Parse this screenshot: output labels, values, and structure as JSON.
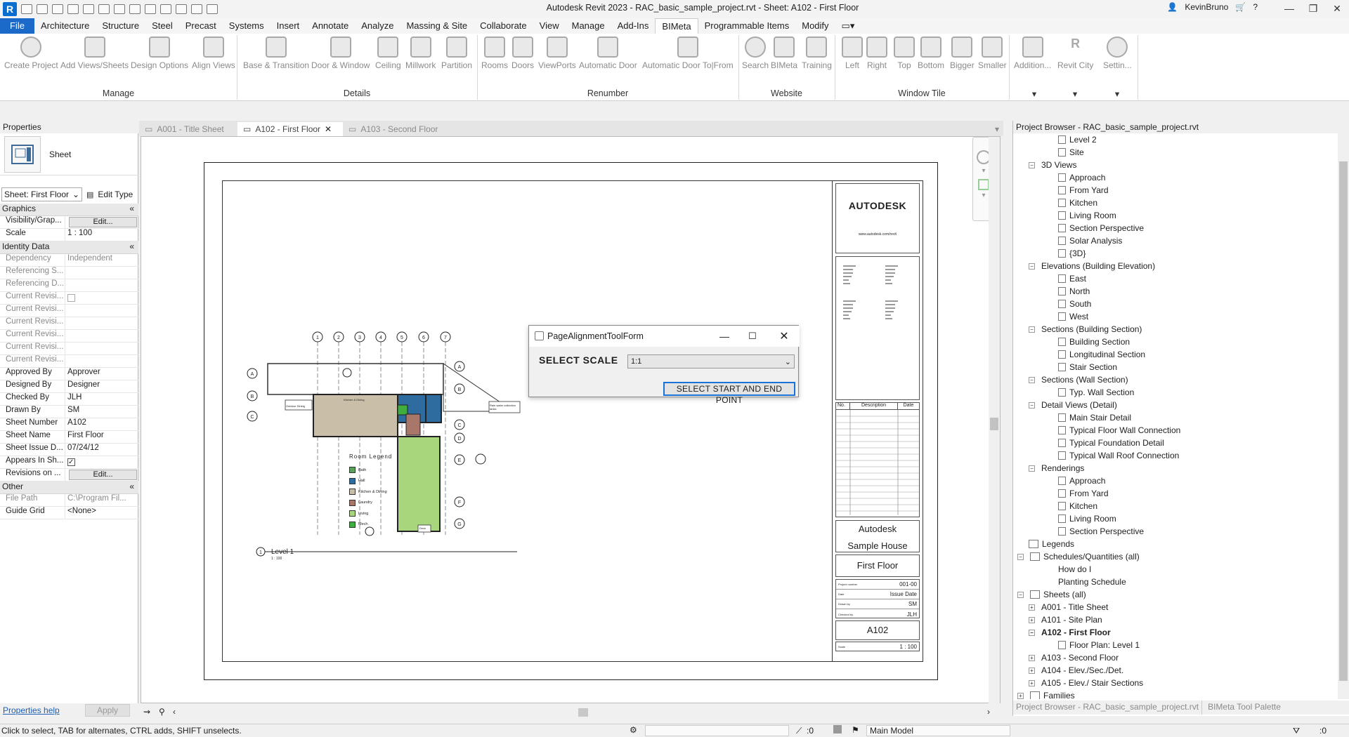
{
  "app": {
    "title": "Autodesk Revit 2023 - RAC_basic_sample_project.rvt - Sheet: A102 - First Floor",
    "user": "KevinBruno",
    "accent": "#1b6ac9"
  },
  "menu_tabs": [
    "File",
    "Architecture",
    "Structure",
    "Steel",
    "Precast",
    "Systems",
    "Insert",
    "Annotate",
    "Analyze",
    "Massing & Site",
    "Collaborate",
    "View",
    "Manage",
    "Add-Ins",
    "BIMeta",
    "Programmable Items",
    "Modify"
  ],
  "active_tab": "BIMeta",
  "ribbon": {
    "buttons": [
      "Create Project",
      "Add Views/Sheets",
      "Design Options",
      "Align Views",
      "Base & Transition",
      "Door & Window",
      "Ceiling",
      "Millwork",
      "Partition",
      "Rooms",
      "Doors",
      "ViewPorts",
      "Automatic Door",
      "Automatic Door To|From",
      "Search",
      "BIMeta",
      "Training",
      "Left",
      "Right",
      "Top",
      "Bottom",
      "Bigger",
      "Smaller",
      "Addition...",
      "Revit City",
      "Settin..."
    ],
    "groups": [
      "Manage",
      "Details",
      "Renumber",
      "Website",
      "Window Tile"
    ]
  },
  "properties": {
    "title": "Properties",
    "type_name": "Sheet",
    "selector": "Sheet: First Floor",
    "edit_type": "Edit Type",
    "sections": {
      "graphics": "Graphics",
      "identity": "Identity Data",
      "other": "Other"
    },
    "rows": {
      "visibility": {
        "k": "Visibility/Grap...",
        "v": "Edit..."
      },
      "scale": {
        "k": "Scale",
        "v": "1 : 100"
      },
      "dependency": {
        "k": "Dependency",
        "v": "Independent"
      },
      "ref_s": {
        "k": "Referencing S...",
        "v": ""
      },
      "ref_d": {
        "k": "Referencing D...",
        "v": ""
      },
      "cur1": {
        "k": "Current Revisi...",
        "v": ""
      },
      "cur2": {
        "k": "Current Revisi...",
        "v": ""
      },
      "cur3": {
        "k": "Current Revisi...",
        "v": ""
      },
      "cur4": {
        "k": "Current Revisi...",
        "v": ""
      },
      "cur5": {
        "k": "Current Revisi...",
        "v": ""
      },
      "cur6": {
        "k": "Current Revisi...",
        "v": ""
      },
      "approved": {
        "k": "Approved By",
        "v": "Approver"
      },
      "designed": {
        "k": "Designed By",
        "v": "Designer"
      },
      "checked": {
        "k": "Checked By",
        "v": "JLH"
      },
      "drawn": {
        "k": "Drawn By",
        "v": "SM"
      },
      "number": {
        "k": "Sheet Number",
        "v": "A102"
      },
      "name": {
        "k": "Sheet Name",
        "v": "First Floor"
      },
      "issue": {
        "k": "Sheet Issue D...",
        "v": "07/24/12"
      },
      "appears": {
        "k": "Appears In Sh...",
        "v": ""
      },
      "revisions": {
        "k": "Revisions on ...",
        "v": "Edit..."
      },
      "filepath": {
        "k": "File Path",
        "v": "C:\\Program Fil..."
      },
      "guide": {
        "k": "Guide Grid",
        "v": "<None>"
      }
    },
    "help": "Properties help",
    "apply": "Apply"
  },
  "view_tabs": [
    "A001 - Title Sheet",
    "A102 - First Floor",
    "A103 - Second Floor"
  ],
  "sheet": {
    "brand": "AUTODESK",
    "website": "www.autodesk.com/revit",
    "rev_headers": [
      "No.",
      "Description",
      "Date"
    ],
    "client": "Autodesk",
    "project": "Sample House",
    "sheet_name": "First Floor",
    "fields": [
      {
        "k": "Project number",
        "v": "001-00"
      },
      {
        "k": "Date",
        "v": "Issue Date"
      },
      {
        "k": "Drawn by",
        "v": "SM"
      },
      {
        "k": "Checked by",
        "v": "JLH"
      }
    ],
    "sheet_number": "A102",
    "scale_label": "Scale",
    "scale": "1 : 100",
    "view_title": "Level 1",
    "view_scale": "1 : 100",
    "legend_title": "Room Legend",
    "legend": [
      {
        "name": "Bath",
        "color": "#5aa25a"
      },
      {
        "name": "Hall",
        "color": "#2e6b9e"
      },
      {
        "name": "Kitchen & Dining",
        "color": "#c9bfa8"
      },
      {
        "name": "Laundry",
        "color": "#a9776a"
      },
      {
        "name": "Living",
        "color": "#a8d67c"
      },
      {
        "name": "Mech.",
        "color": "#3fae3f"
      }
    ],
    "tags": {
      "outdoor": "Outdoor Dining",
      "rain": "Rain water collection tanks",
      "deck": "Deck",
      "kitchen": "Kitchen & Dining"
    },
    "grid_numbers": [
      "1",
      "2",
      "3",
      "4",
      "5",
      "6",
      "7"
    ],
    "grid_letters": [
      "A",
      "B",
      "C",
      "D",
      "E",
      "F",
      "G"
    ]
  },
  "dialog": {
    "title": "PageAlignmentToolForm",
    "scale_label": "SELECT SCALE",
    "scale_value": "1:1",
    "button": "SELECT START AND END POINT"
  },
  "browser": {
    "title": "Project Browser - RAC_basic_sample_project.rvt",
    "tab1": "Project Browser - RAC_basic_sample_project.rvt",
    "tab2": "BIMeta Tool Palette",
    "nodes": {
      "level2": "Level 2",
      "site": "Site",
      "views3d": "3D Views",
      "approach": "Approach",
      "fromyard": "From Yard",
      "kitchen": "Kitchen",
      "living": "Living Room",
      "secpersp": "Section Perspective",
      "solar": "Solar Analysis",
      "v3d": "{3D}",
      "elev": "Elevations (Building Elevation)",
      "east": "East",
      "north": "North",
      "south": "South",
      "west": "West",
      "secb": "Sections (Building Section)",
      "bsec": "Building Section",
      "lsec": "Longitudinal Section",
      "ssec": "Stair Section",
      "secw": "Sections (Wall Section)",
      "twsec": "Typ. Wall Section",
      "detv": "Detail Views (Detail)",
      "msd": "Main Stair Detail",
      "tfwc": "Typical Floor Wall Connection",
      "tfd": "Typical Foundation Detail",
      "twrc": "Typical Wall Roof Connection",
      "rend": "Renderings",
      "r_app": "Approach",
      "r_fy": "From Yard",
      "r_k": "Kitchen",
      "r_lr": "Living Room",
      "r_sp": "Section Perspective",
      "legends": "Legends",
      "sched": "Schedules/Quantities (all)",
      "howdo": "How do I",
      "plant": "Planting Schedule",
      "sheets": "Sheets (all)",
      "a001": "A001 - Title Sheet",
      "a101": "A101 - Site Plan",
      "a102": "A102 - First Floor",
      "fpl1": "Floor Plan: Level 1",
      "a103": "A103 - Second Floor",
      "a104": "A104 - Elev./Sec./Det.",
      "a105": "A105 - Elev./ Stair Sections",
      "fam": "Families"
    }
  },
  "status": {
    "hint": "Click to select, TAB for alternates, CTRL adds, SHIFT unselects.",
    "model": "Main Model",
    "count1": ":0",
    "count2": ":0"
  }
}
